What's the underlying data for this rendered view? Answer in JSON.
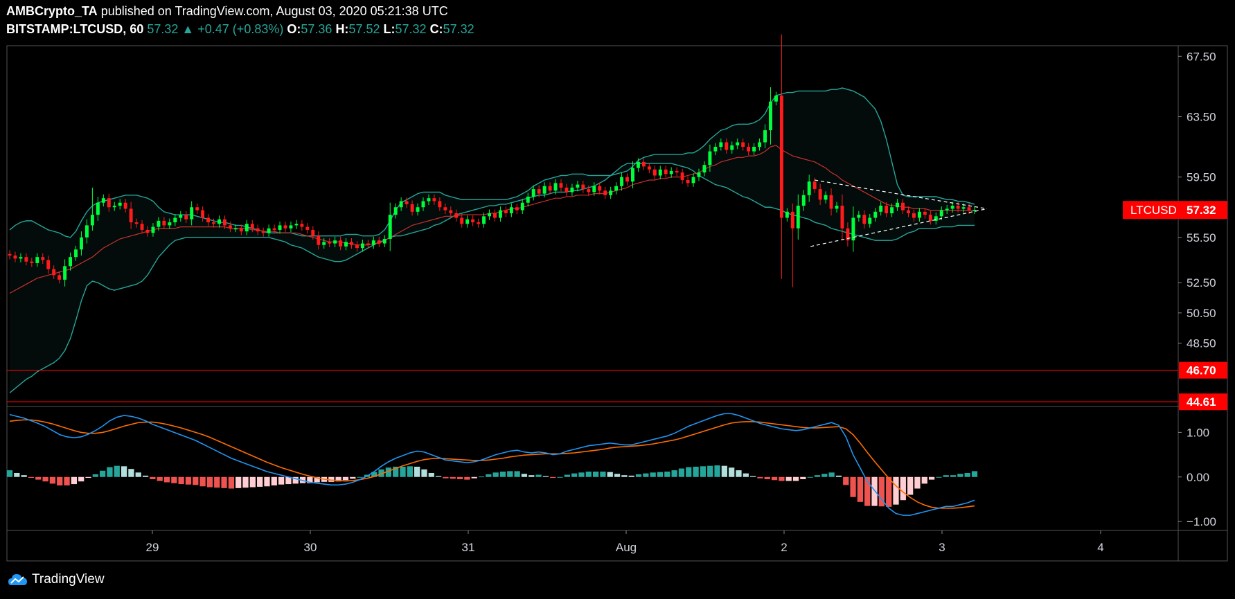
{
  "header": {
    "author": "AMBCrypto_TA",
    "published": "published on TradingView.com, August 03, 2020 05:21:38 UTC",
    "symbol": "BITSTAMP:LTCUSD, 60",
    "last": "57.32",
    "change": "+0.47 (+0.83%)",
    "o_label": "O:",
    "o": "57.36",
    "h_label": "H:",
    "h": "57.52",
    "l_label": "L:",
    "l": "57.32",
    "c_label": "C:",
    "c": "57.32"
  },
  "footer": {
    "brand": "TradingView"
  },
  "colors": {
    "background": "#000000",
    "up": "#00ff3b",
    "down": "#ff1b1b",
    "bb_band": "#26a69a",
    "bb_mid": "#c8312f",
    "macd": "#2196f3",
    "signal": "#ff6d00",
    "level": "#ff0000",
    "axis_text": "#d1d4dc"
  },
  "chart_data": [
    {
      "type": "candlestick",
      "x_ticks": [
        "29",
        "30",
        "31",
        "Aug",
        "2",
        "3",
        "4"
      ],
      "y_ticks": [
        "67.50",
        "63.50",
        "59.50",
        "55.50",
        "52.50",
        "50.50",
        "48.50"
      ],
      "ylim": [
        44.3,
        68.2
      ],
      "price_label": {
        "name": "LTCUSD",
        "value": 57.32,
        "text": "57.32"
      },
      "horizontal_levels": [
        {
          "value": 46.7,
          "text": "46.70"
        },
        {
          "value": 44.61,
          "text": "44.61"
        }
      ],
      "series": [
        {
          "name": "Close",
          "values": [
            54.3,
            54.1,
            54.2,
            53.9,
            53.8,
            54.2,
            54.0,
            53.4,
            53.0,
            52.7,
            53.6,
            54.2,
            54.7,
            55.5,
            56.3,
            57.0,
            57.8,
            58.1,
            57.5,
            57.6,
            57.8,
            57.4,
            56.5,
            56.4,
            56.0,
            55.8,
            56.2,
            56.6,
            56.3,
            56.5,
            56.8,
            57.0,
            56.7,
            57.5,
            57.3,
            56.8,
            56.5,
            56.4,
            56.7,
            56.3,
            56.1,
            56.1,
            55.9,
            56.4,
            56.1,
            55.9,
            55.8,
            56.1,
            56.0,
            56.3,
            56.1,
            56.3,
            56.4,
            56.2,
            56.0,
            55.6,
            55.0,
            55.2,
            55.1,
            55.3,
            54.9,
            55.2,
            55.0,
            54.8,
            55.1,
            55.0,
            55.3,
            55.1,
            55.4,
            57.0,
            57.5,
            57.9,
            57.7,
            57.2,
            57.5,
            57.9,
            58.1,
            57.9,
            57.5,
            57.3,
            57.1,
            56.8,
            56.4,
            56.7,
            56.5,
            56.4,
            56.9,
            57.1,
            56.8,
            57.3,
            57.1,
            57.5,
            57.3,
            57.8,
            58.2,
            58.7,
            58.4,
            58.9,
            58.6,
            59.1,
            58.8,
            58.5,
            58.8,
            59.0,
            58.7,
            58.5,
            58.9,
            58.6,
            58.3,
            58.6,
            58.9,
            59.5,
            59.2,
            60.1,
            60.5,
            60.2,
            60.0,
            59.6,
            60.0,
            59.7,
            59.9,
            59.8,
            59.3,
            59.1,
            59.5,
            59.8,
            60.3,
            61.2,
            61.5,
            61.8,
            61.3,
            61.6,
            61.8,
            61.5,
            61.2,
            61.5,
            61.8,
            62.6,
            64.5,
            64.9,
            56.8,
            57.2,
            56.1,
            57.6,
            58.3,
            59.2,
            58.7,
            58.0,
            58.3,
            57.4,
            57.6,
            56.1,
            55.3,
            56.8,
            57.0,
            56.4,
            56.8,
            57.2,
            57.6,
            57.1,
            57.5,
            57.8,
            57.3,
            57.1,
            56.8,
            57.2,
            57.0,
            56.6,
            56.9,
            57.3,
            57.4,
            57.6,
            57.4,
            57.5,
            57.3,
            57.32
          ]
        },
        {
          "name": "BB upper",
          "values": [
            56.0,
            56.3,
            56.5,
            56.6,
            56.6,
            56.4,
            56.2,
            56.0,
            55.9,
            55.8,
            55.6,
            55.5,
            55.9,
            56.6,
            57.2,
            57.6,
            57.8,
            57.9,
            58.0,
            58.1,
            58.2,
            58.3,
            58.3,
            58.3,
            58.2,
            58.1,
            57.9,
            57.5,
            57.2,
            57.1,
            57.0,
            57.0,
            57.0,
            57.0,
            56.9,
            56.8,
            56.7,
            56.6,
            56.5,
            56.5,
            56.4,
            56.3,
            56.3,
            56.2,
            56.1,
            56.0,
            55.9,
            55.8,
            55.8,
            55.8,
            55.8,
            55.8,
            55.7,
            55.6,
            55.6,
            55.6,
            55.6,
            55.6,
            55.6,
            55.6,
            55.6,
            55.7,
            55.7,
            55.7,
            55.6,
            55.6,
            55.6,
            55.7,
            56.0,
            56.6,
            57.3,
            57.8,
            58.0,
            58.2,
            58.4,
            58.5,
            58.5,
            58.5,
            58.5,
            58.3,
            58.2,
            58.1,
            58.0,
            58.0,
            58.0,
            58.0,
            58.0,
            58.0,
            58.0,
            58.0,
            58.0,
            58.1,
            58.2,
            58.4,
            58.6,
            58.9,
            59.1,
            59.3,
            59.4,
            59.5,
            59.6,
            59.6,
            59.7,
            59.7,
            59.7,
            59.6,
            59.6,
            59.6,
            59.6,
            59.6,
            59.7,
            59.8,
            59.9,
            60.2,
            60.6,
            60.8,
            60.9,
            61.0,
            61.0,
            61.0,
            61.0,
            61.0,
            61.0,
            61.1,
            61.1,
            61.3,
            61.6,
            62.0,
            62.3,
            62.6,
            62.7,
            62.9,
            63.0,
            63.0,
            63.0,
            63.1,
            63.3,
            63.7,
            64.4,
            64.9,
            65.0,
            65.1,
            65.1,
            65.2,
            65.2,
            65.2,
            65.2,
            65.2,
            65.2,
            65.3,
            65.3,
            65.4,
            65.3,
            65.2,
            65.0,
            64.8,
            64.4,
            64.0,
            63.2,
            62.0,
            60.5,
            59.0,
            58.3,
            58.2,
            58.2,
            58.2,
            58.2,
            58.2,
            58.2,
            58.1,
            58.0,
            58.0,
            57.9,
            57.9,
            57.8,
            57.7
          ]
        },
        {
          "name": "BB basis",
          "values": [
            51.8,
            52.0,
            52.2,
            52.4,
            52.6,
            52.8,
            52.9,
            53.0,
            53.1,
            53.2,
            53.3,
            53.4,
            53.6,
            53.8,
            54.0,
            54.2,
            54.5,
            54.8,
            55.0,
            55.2,
            55.4,
            55.5,
            55.6,
            55.7,
            55.8,
            55.9,
            56.0,
            56.1,
            56.1,
            56.1,
            56.1,
            56.2,
            56.2,
            56.2,
            56.2,
            56.2,
            56.2,
            56.2,
            56.2,
            56.2,
            56.1,
            56.1,
            56.1,
            56.1,
            56.0,
            56.0,
            55.9,
            55.9,
            55.9,
            55.8,
            55.8,
            55.8,
            55.8,
            55.7,
            55.6,
            55.5,
            55.4,
            55.3,
            55.2,
            55.2,
            55.2,
            55.1,
            55.1,
            55.0,
            55.0,
            55.0,
            55.1,
            55.1,
            55.3,
            55.5,
            55.7,
            55.9,
            56.1,
            56.3,
            56.4,
            56.5,
            56.6,
            56.7,
            56.8,
            56.9,
            56.9,
            56.9,
            57.0,
            57.0,
            57.0,
            57.0,
            57.0,
            57.1,
            57.1,
            57.2,
            57.3,
            57.4,
            57.4,
            57.5,
            57.6,
            57.7,
            57.8,
            57.9,
            58.0,
            58.1,
            58.1,
            58.2,
            58.2,
            58.3,
            58.3,
            58.3,
            58.4,
            58.4,
            58.4,
            58.5,
            58.6,
            58.7,
            58.8,
            59.0,
            59.1,
            59.2,
            59.3,
            59.3,
            59.4,
            59.4,
            59.5,
            59.5,
            59.5,
            59.6,
            59.7,
            59.8,
            60.0,
            60.2,
            60.3,
            60.5,
            60.6,
            60.7,
            60.8,
            60.8,
            60.9,
            60.9,
            61.0,
            61.2,
            61.5,
            61.6,
            61.3,
            61.1,
            60.9,
            60.8,
            60.7,
            60.6,
            60.5,
            60.3,
            60.1,
            59.8,
            59.6,
            59.3,
            59.1,
            58.9,
            58.7,
            58.5,
            58.3,
            58.1,
            57.9,
            57.7,
            57.6,
            57.6,
            57.5,
            57.5,
            57.4,
            57.4,
            57.4,
            57.3,
            57.3,
            57.3,
            57.3,
            57.3,
            57.3,
            57.3,
            57.3,
            57.3
          ]
        },
        {
          "name": "BB lower",
          "values": [
            45.2,
            45.5,
            45.8,
            46.1,
            46.3,
            46.6,
            46.8,
            47.0,
            47.2,
            47.5,
            48.0,
            48.8,
            50.0,
            51.3,
            52.3,
            52.6,
            52.5,
            52.3,
            52.1,
            52.0,
            52.1,
            52.2,
            52.3,
            52.4,
            52.6,
            53.0,
            53.6,
            54.2,
            54.6,
            55.0,
            55.3,
            55.4,
            55.5,
            55.5,
            55.5,
            55.5,
            55.5,
            55.5,
            55.5,
            55.5,
            55.5,
            55.5,
            55.5,
            55.5,
            55.5,
            55.5,
            55.5,
            55.5,
            55.4,
            55.3,
            55.2,
            55.0,
            54.9,
            54.8,
            54.6,
            54.4,
            54.2,
            54.1,
            54.0,
            53.9,
            53.9,
            54.0,
            54.2,
            54.4,
            54.6,
            54.8,
            55.0,
            55.2,
            55.3,
            55.5,
            55.6,
            55.6,
            55.7,
            55.8,
            55.9,
            56.0,
            56.1,
            56.3,
            56.4,
            56.6,
            56.8,
            57.0,
            57.1,
            57.2,
            57.3,
            57.4,
            57.5,
            57.6,
            57.6,
            57.7,
            57.7,
            57.8,
            57.9,
            58.0,
            58.1,
            58.2,
            58.3,
            58.3,
            58.4,
            58.5,
            58.5,
            58.5,
            58.6,
            58.6,
            58.7,
            58.8,
            58.9,
            59.1,
            59.3,
            59.6,
            59.9,
            60.2,
            60.4,
            60.4,
            60.4,
            60.4,
            60.4,
            60.4,
            60.4,
            60.4,
            60.4,
            60.3,
            60.2,
            60.1,
            59.9,
            59.6,
            59.4,
            59.2,
            59.0,
            58.9,
            58.8,
            58.6,
            58.4,
            58.2,
            58.1,
            57.9,
            57.7,
            57.5,
            57.5,
            57.4,
            57.3,
            57.1,
            57.0,
            56.9,
            56.8,
            56.7,
            56.5,
            56.4,
            56.3,
            56.1,
            56.0,
            55.9,
            55.8,
            55.7,
            55.6,
            55.5,
            55.4,
            55.3,
            55.3,
            55.3,
            55.3,
            55.4,
            55.6,
            55.8,
            55.9,
            56.1,
            56.1,
            56.1,
            56.1,
            56.2,
            56.2,
            56.2,
            56.3,
            56.3,
            56.3,
            56.3
          ]
        }
      ],
      "annotations": [
        "symmetrical triangle (dashed white trendlines)"
      ]
    },
    {
      "type": "line",
      "name": "MACD",
      "y_ticks": [
        "1.00",
        "0.00",
        "−1.00"
      ],
      "ylim": [
        -1.2,
        1.55
      ],
      "series": [
        {
          "name": "MACD",
          "values": [
            1.4,
            1.36,
            1.32,
            1.26,
            1.2,
            1.13,
            1.04,
            0.95,
            0.9,
            0.88,
            0.9,
            0.96,
            1.04,
            1.14,
            1.26,
            1.34,
            1.38,
            1.36,
            1.32,
            1.26,
            1.18,
            1.12,
            1.06,
            1.0,
            0.94,
            0.88,
            0.82,
            0.74,
            0.66,
            0.58,
            0.5,
            0.42,
            0.36,
            0.3,
            0.24,
            0.18,
            0.12,
            0.08,
            0.04,
            0.0,
            -0.04,
            -0.08,
            -0.12,
            -0.14,
            -0.16,
            -0.18,
            -0.18,
            -0.16,
            -0.12,
            -0.06,
            0.02,
            0.12,
            0.24,
            0.34,
            0.42,
            0.48,
            0.54,
            0.58,
            0.56,
            0.5,
            0.44,
            0.38,
            0.36,
            0.34,
            0.32,
            0.34,
            0.38,
            0.44,
            0.5,
            0.54,
            0.58,
            0.6,
            0.56,
            0.54,
            0.56,
            0.54,
            0.5,
            0.52,
            0.58,
            0.62,
            0.66,
            0.7,
            0.72,
            0.74,
            0.76,
            0.74,
            0.72,
            0.72,
            0.76,
            0.8,
            0.84,
            0.88,
            0.92,
            0.98,
            1.06,
            1.14,
            1.2,
            1.26,
            1.32,
            1.38,
            1.42,
            1.42,
            1.38,
            1.32,
            1.26,
            1.2,
            1.16,
            1.12,
            1.08,
            1.06,
            1.04,
            1.06,
            1.1,
            1.14,
            1.18,
            1.22,
            1.16,
            0.9,
            0.5,
            0.2,
            -0.1,
            -0.3,
            -0.5,
            -0.7,
            -0.82,
            -0.86,
            -0.86,
            -0.82,
            -0.78,
            -0.74,
            -0.7,
            -0.66,
            -0.66,
            -0.62,
            -0.58,
            -0.52
          ]
        },
        {
          "name": "Signal",
          "values": [
            1.25,
            1.27,
            1.28,
            1.28,
            1.26,
            1.23,
            1.19,
            1.14,
            1.09,
            1.04,
            1.0,
            0.98,
            0.98,
            1.0,
            1.04,
            1.09,
            1.14,
            1.18,
            1.22,
            1.23,
            1.23,
            1.21,
            1.18,
            1.14,
            1.1,
            1.05,
            1.0,
            0.95,
            0.89,
            0.82,
            0.75,
            0.68,
            0.61,
            0.54,
            0.47,
            0.4,
            0.33,
            0.27,
            0.21,
            0.16,
            0.11,
            0.06,
            0.02,
            -0.02,
            -0.05,
            -0.07,
            -0.08,
            -0.09,
            -0.08,
            -0.06,
            -0.03,
            0.01,
            0.07,
            0.13,
            0.19,
            0.25,
            0.3,
            0.35,
            0.39,
            0.41,
            0.42,
            0.41,
            0.4,
            0.39,
            0.38,
            0.37,
            0.37,
            0.38,
            0.4,
            0.42,
            0.45,
            0.47,
            0.49,
            0.5,
            0.51,
            0.52,
            0.52,
            0.52,
            0.53,
            0.54,
            0.56,
            0.58,
            0.6,
            0.62,
            0.65,
            0.67,
            0.68,
            0.69,
            0.7,
            0.72,
            0.74,
            0.77,
            0.8,
            0.83,
            0.87,
            0.92,
            0.97,
            1.02,
            1.07,
            1.12,
            1.17,
            1.21,
            1.23,
            1.24,
            1.24,
            1.23,
            1.21,
            1.19,
            1.17,
            1.15,
            1.13,
            1.11,
            1.1,
            1.1,
            1.11,
            1.12,
            1.13,
            1.08,
            0.95,
            0.76,
            0.55,
            0.35,
            0.16,
            -0.03,
            -0.2,
            -0.34,
            -0.46,
            -0.56,
            -0.63,
            -0.68,
            -0.7,
            -0.7,
            -0.7,
            -0.69,
            -0.67,
            -0.65
          ]
        }
      ]
    }
  ]
}
